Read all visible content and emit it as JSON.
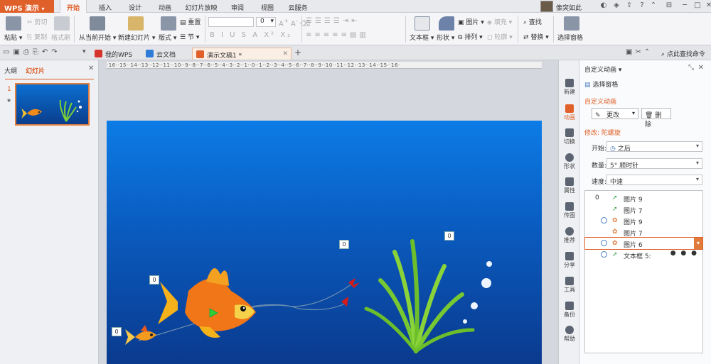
{
  "app": {
    "title": "WPS 演示",
    "menu_tabs": [
      "开始",
      "插入",
      "设计",
      "动画",
      "幻灯片放映",
      "审阅",
      "视图",
      "云服务"
    ],
    "active_tab": "开始",
    "user_name": "像突如此"
  },
  "ribbon": {
    "paste": "粘贴",
    "cut": "剪切",
    "copy": "复制",
    "format_painter": "格式刷",
    "from_current": "从当前开始",
    "new_slide": "新建幻灯片",
    "layout": "版式",
    "section": "节",
    "reset": "重置",
    "font_size": "0",
    "text_box": "文本框",
    "shape": "形状",
    "picture": "图片",
    "fill": "填充",
    "arrange": "排列",
    "outline": "轮廓",
    "find": "查找",
    "replace": "替换",
    "select_pane": "选择窗格"
  },
  "tabsbar": {
    "tabs": [
      {
        "label": "我的WPS",
        "color": "#d6342a"
      },
      {
        "label": "云文档",
        "color": "#2f7bd8"
      },
      {
        "label": "演示文稿1 *",
        "color": "#e0602a"
      }
    ],
    "search": "点此查找命令"
  },
  "leftpanel": {
    "outline_tab": "大纲",
    "slides_tab": "幻灯片",
    "slide_number": "1",
    "star": "★"
  },
  "ruler": {
    "text": "·16··15··14··13··12··11··10··9··8··7··6··5··4··3··2··1··0··1··2··3··4··5··6··7··8··9··10··11··12··13··14··15··16·"
  },
  "slide": {
    "anim_tags": [
      "0",
      "0",
      "0",
      "0"
    ]
  },
  "sidebar": {
    "items": [
      "新建",
      "动画",
      "切换",
      "形状",
      "属性",
      "传图",
      "推荐",
      "分享",
      "工具",
      "备份",
      "帮助"
    ],
    "active": "动画"
  },
  "taskpane": {
    "title": "自定义动画 ▾",
    "select_pane": "选择窗格",
    "section": "自定义动画",
    "change_button": "更改",
    "delete_button": "删除",
    "modify_label": "修改: 陀螺旋",
    "start_label": "开始:",
    "start_value": "之后",
    "amount_label": "数量:",
    "amount_value": "5° 顺时针",
    "speed_label": "速度:",
    "speed_value": "中速",
    "list": [
      {
        "num": "0",
        "clock": false,
        "effect": "path",
        "name": "图片 9",
        "selected": false
      },
      {
        "num": "",
        "clock": false,
        "effect": "path",
        "name": "图片 7",
        "selected": false
      },
      {
        "num": "",
        "clock": true,
        "effect": "spin",
        "name": "图片 9",
        "selected": false
      },
      {
        "num": "",
        "clock": false,
        "effect": "spin",
        "name": "图片 7",
        "selected": false
      },
      {
        "num": "",
        "clock": true,
        "effect": "spin",
        "name": "图片 6",
        "selected": true
      },
      {
        "num": "",
        "clock": true,
        "effect": "path",
        "name": "文本框 5:",
        "selected": false
      }
    ],
    "dots": "● ● ●"
  }
}
